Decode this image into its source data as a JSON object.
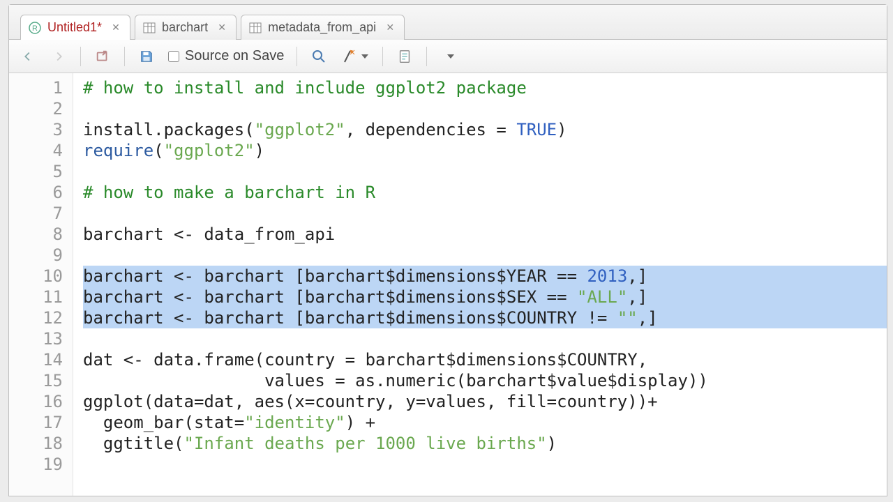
{
  "tabs": [
    {
      "label": "Untitled1*",
      "kind": "script",
      "active": true
    },
    {
      "label": "barchart",
      "kind": "data",
      "active": false
    },
    {
      "label": "metadata_from_api",
      "kind": "data",
      "active": false
    }
  ],
  "toolbar": {
    "source_on_save_label": "Source on Save"
  },
  "lines": [
    {
      "n": "1",
      "sel": false,
      "seg": [
        {
          "t": "# how to install and include ggplot2 package",
          "c": "tok-comment"
        }
      ]
    },
    {
      "n": "2",
      "sel": false,
      "seg": [
        {
          "t": ""
        }
      ]
    },
    {
      "n": "3",
      "sel": false,
      "seg": [
        {
          "t": "install.packages("
        },
        {
          "t": "\"ggplot2\"",
          "c": "tok-str"
        },
        {
          "t": ", dependencies = "
        },
        {
          "t": "TRUE",
          "c": "tok-const"
        },
        {
          "t": ")"
        }
      ]
    },
    {
      "n": "4",
      "sel": false,
      "seg": [
        {
          "t": "require",
          "c": "tok-fn"
        },
        {
          "t": "("
        },
        {
          "t": "\"ggplot2\"",
          "c": "tok-str"
        },
        {
          "t": ")"
        }
      ]
    },
    {
      "n": "5",
      "sel": false,
      "seg": [
        {
          "t": ""
        }
      ]
    },
    {
      "n": "6",
      "sel": false,
      "seg": [
        {
          "t": "# how to make a barchart in R",
          "c": "tok-comment"
        }
      ]
    },
    {
      "n": "7",
      "sel": false,
      "seg": [
        {
          "t": ""
        }
      ]
    },
    {
      "n": "8",
      "sel": false,
      "seg": [
        {
          "t": "barchart <- data_from_api"
        }
      ]
    },
    {
      "n": "9",
      "sel": false,
      "seg": [
        {
          "t": ""
        }
      ]
    },
    {
      "n": "10",
      "sel": true,
      "seg": [
        {
          "t": "barchart <- barchart [barchart$dimensions$YEAR == "
        },
        {
          "t": "2013",
          "c": "tok-num"
        },
        {
          "t": ",]"
        }
      ]
    },
    {
      "n": "11",
      "sel": true,
      "seg": [
        {
          "t": "barchart <- barchart [barchart$dimensions$SEX == "
        },
        {
          "t": "\"ALL\"",
          "c": "tok-str"
        },
        {
          "t": ",]"
        }
      ]
    },
    {
      "n": "12",
      "sel": true,
      "seg": [
        {
          "t": "barchart <- barchart [barchart$dimensions$COUNTRY != "
        },
        {
          "t": "\"\"",
          "c": "tok-str"
        },
        {
          "t": ",]"
        }
      ]
    },
    {
      "n": "13",
      "sel": false,
      "seg": [
        {
          "t": ""
        }
      ]
    },
    {
      "n": "14",
      "sel": false,
      "seg": [
        {
          "t": "dat <- data.frame(country = barchart$dimensions$COUNTRY,"
        }
      ]
    },
    {
      "n": "15",
      "sel": false,
      "seg": [
        {
          "t": "                  values = as.numeric(barchart$value$display))"
        }
      ]
    },
    {
      "n": "16",
      "sel": false,
      "seg": [
        {
          "t": "ggplot(data=dat, aes(x=country, y=values, fill=country))+"
        }
      ]
    },
    {
      "n": "17",
      "sel": false,
      "seg": [
        {
          "t": "  geom_bar(stat="
        },
        {
          "t": "\"identity\"",
          "c": "tok-str"
        },
        {
          "t": ") +"
        }
      ]
    },
    {
      "n": "18",
      "sel": false,
      "seg": [
        {
          "t": "  ggtitle("
        },
        {
          "t": "\"Infant deaths per 1000 live births\"",
          "c": "tok-str"
        },
        {
          "t": ")"
        }
      ]
    },
    {
      "n": "19",
      "sel": false,
      "seg": [
        {
          "t": ""
        }
      ]
    }
  ]
}
